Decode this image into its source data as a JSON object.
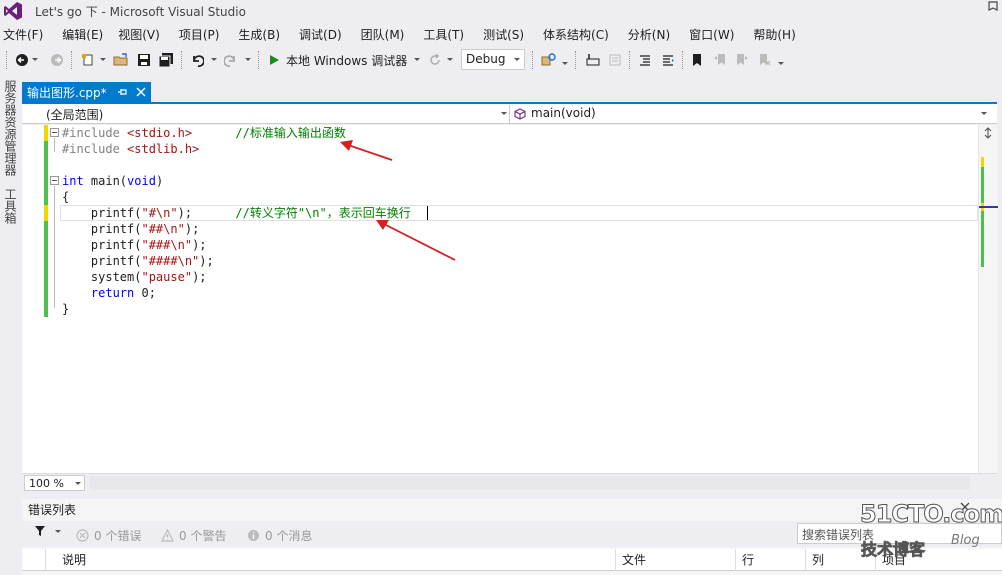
{
  "window": {
    "title": "Let's go 下 - Microsoft Visual Studio"
  },
  "menu": [
    "文件(F)",
    "编辑(E)",
    "视图(V)",
    "项目(P)",
    "生成(B)",
    "调试(D)",
    "团队(M)",
    "工具(T)",
    "测试(S)",
    "体系结构(C)",
    "分析(N)",
    "窗口(W)",
    "帮助(H)"
  ],
  "toolbar": {
    "run_label": "本地 Windows 调试器",
    "config": "Debug"
  },
  "left_panel": {
    "tab1": "服务器资源管理器",
    "tab2": "工具箱"
  },
  "document": {
    "tab_label": "输出图形.cpp*",
    "scope": "(全局范围)",
    "function": "main(void)"
  },
  "code": [
    {
      "seg": [
        [
          "pp",
          "#include "
        ],
        [
          "hdr",
          "<stdio.h>"
        ],
        [
          "plain",
          "      "
        ],
        [
          "cmt",
          "//标准输入输出函数"
        ]
      ]
    },
    {
      "seg": [
        [
          "pp",
          "#include "
        ],
        [
          "hdr",
          "<stdlib.h>"
        ]
      ]
    },
    {
      "seg": [
        [
          "plain",
          ""
        ]
      ]
    },
    {
      "seg": [
        [
          "kw",
          "int"
        ],
        [
          "plain",
          " main("
        ],
        [
          "kw",
          "void"
        ],
        [
          "plain",
          ")"
        ]
      ]
    },
    {
      "seg": [
        [
          "plain",
          "{"
        ]
      ]
    },
    {
      "seg": [
        [
          "plain",
          "    printf("
        ],
        [
          "str",
          "\"#\\n\""
        ],
        [
          "plain",
          ");      "
        ],
        [
          "cmt",
          "//转义字符\"\\n\"，表示回车换行"
        ]
      ]
    },
    {
      "seg": [
        [
          "plain",
          "    printf("
        ],
        [
          "str",
          "\"##\\n\""
        ],
        [
          "plain",
          ");"
        ]
      ]
    },
    {
      "seg": [
        [
          "plain",
          "    printf("
        ],
        [
          "str",
          "\"###\\n\""
        ],
        [
          "plain",
          ");"
        ]
      ]
    },
    {
      "seg": [
        [
          "plain",
          "    printf("
        ],
        [
          "str",
          "\"####\\n\""
        ],
        [
          "plain",
          ");"
        ]
      ]
    },
    {
      "seg": [
        [
          "plain",
          "    system("
        ],
        [
          "str",
          "\"pause\""
        ],
        [
          "plain",
          ");"
        ]
      ]
    },
    {
      "seg": [
        [
          "plain",
          "    "
        ],
        [
          "kw",
          "return"
        ],
        [
          "plain",
          " 0;"
        ]
      ]
    },
    {
      "seg": [
        [
          "plain",
          "}"
        ]
      ]
    }
  ],
  "zoom": "100 %",
  "error_list": {
    "title": "错误列表",
    "errors": "0 个错误",
    "warnings": "0 个警告",
    "messages": "0 个消息",
    "search_placeholder": "搜索错误列表",
    "columns": [
      "说明",
      "文件",
      "行",
      "列",
      "项目"
    ]
  },
  "watermark": {
    "site": "51CTO.com",
    "line2": "技术博客",
    "line3": "Blog"
  },
  "colors": {
    "accent": "#007acc",
    "annotation_arrow": "#d42020"
  }
}
